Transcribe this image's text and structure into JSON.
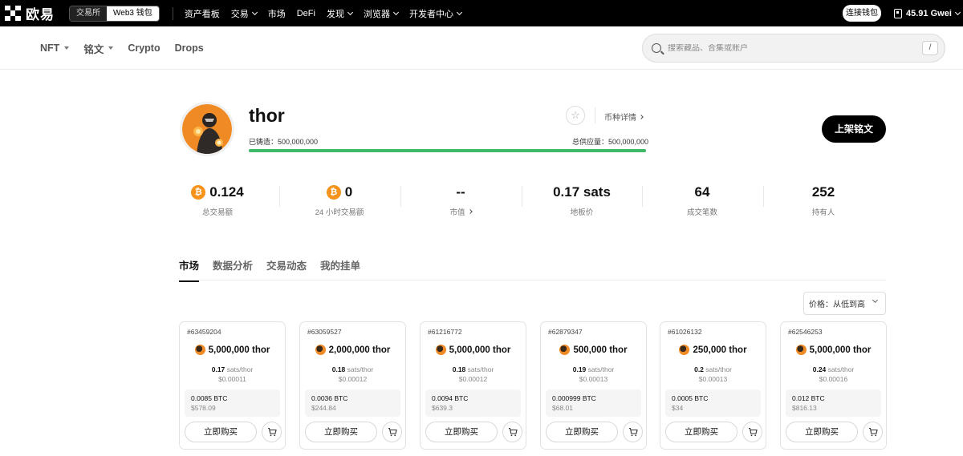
{
  "brand": {
    "name": "欧易"
  },
  "mode": {
    "exchange": "交易所",
    "web3": "Web3 钱包"
  },
  "top_nav": [
    {
      "label": "资产看板",
      "dropdown": false
    },
    {
      "label": "交易",
      "dropdown": true
    },
    {
      "label": "市场",
      "dropdown": false
    },
    {
      "label": "DeFi",
      "dropdown": false
    },
    {
      "label": "发现",
      "dropdown": true
    },
    {
      "label": "浏览器",
      "dropdown": true
    },
    {
      "label": "开发者中心",
      "dropdown": true
    }
  ],
  "connect_wallet": "连接钱包",
  "gas": "45.91 Gwei",
  "sub_nav": [
    {
      "label": "NFT",
      "dropdown": true
    },
    {
      "label": "铭文",
      "dropdown": true
    },
    {
      "label": "Crypto",
      "dropdown": false
    },
    {
      "label": "Drops",
      "dropdown": false
    }
  ],
  "search": {
    "placeholder": "搜索藏品、合集或账户",
    "shortcut": "/"
  },
  "token": {
    "name": "thor",
    "coin_detail": "币种详情",
    "minted": "已铸造：500,000,000",
    "supply": "总供应量：500,000,000",
    "mint_progress": 1.0,
    "list_button": "上架铭文"
  },
  "stats": [
    {
      "value": "0.124",
      "label": "总交易额",
      "btc": true,
      "link": false
    },
    {
      "value": "0",
      "label": "24 小时交易额",
      "btc": true,
      "link": false
    },
    {
      "value": "--",
      "label": "市值",
      "btc": false,
      "link": true
    },
    {
      "value": "0.17 sats",
      "label": "地板价",
      "btc": false,
      "link": false
    },
    {
      "value": "64",
      "label": "成交笔数",
      "btc": false,
      "link": false
    },
    {
      "value": "252",
      "label": "持有人",
      "btc": false,
      "link": false
    }
  ],
  "tabs": [
    "市场",
    "数据分析",
    "交易动态",
    "我的挂单"
  ],
  "sort": {
    "label": "价格：从低到高"
  },
  "buy_label": "立即购买",
  "unit_label": "sats/thor",
  "cards": [
    {
      "id": "#63459204",
      "amount": "5,000,000 thor",
      "price": "0.17",
      "usd_unit": "$0.00011",
      "btc": "0.0085 BTC",
      "usd": "$578.09"
    },
    {
      "id": "#63059527",
      "amount": "2,000,000 thor",
      "price": "0.18",
      "usd_unit": "$0.00012",
      "btc": "0.0036 BTC",
      "usd": "$244.84"
    },
    {
      "id": "#61216772",
      "amount": "5,000,000 thor",
      "price": "0.18",
      "usd_unit": "$0.00012",
      "btc": "0.0094 BTC",
      "usd": "$639.3"
    },
    {
      "id": "#62879347",
      "amount": "500,000 thor",
      "price": "0.19",
      "usd_unit": "$0.00013",
      "btc": "0.000999 BTC",
      "usd": "$68.01"
    },
    {
      "id": "#61026132",
      "amount": "250,000 thor",
      "price": "0.2",
      "usd_unit": "$0.00013",
      "btc": "0.0005 BTC",
      "usd": "$34"
    },
    {
      "id": "#62546253",
      "amount": "5,000,000 thor",
      "price": "0.24",
      "usd_unit": "$0.00016",
      "btc": "0.012 BTC",
      "usd": "$816.13"
    }
  ],
  "colors": {
    "accent": "#000000",
    "progress": "#3fb868",
    "btc": "#f7931a"
  }
}
